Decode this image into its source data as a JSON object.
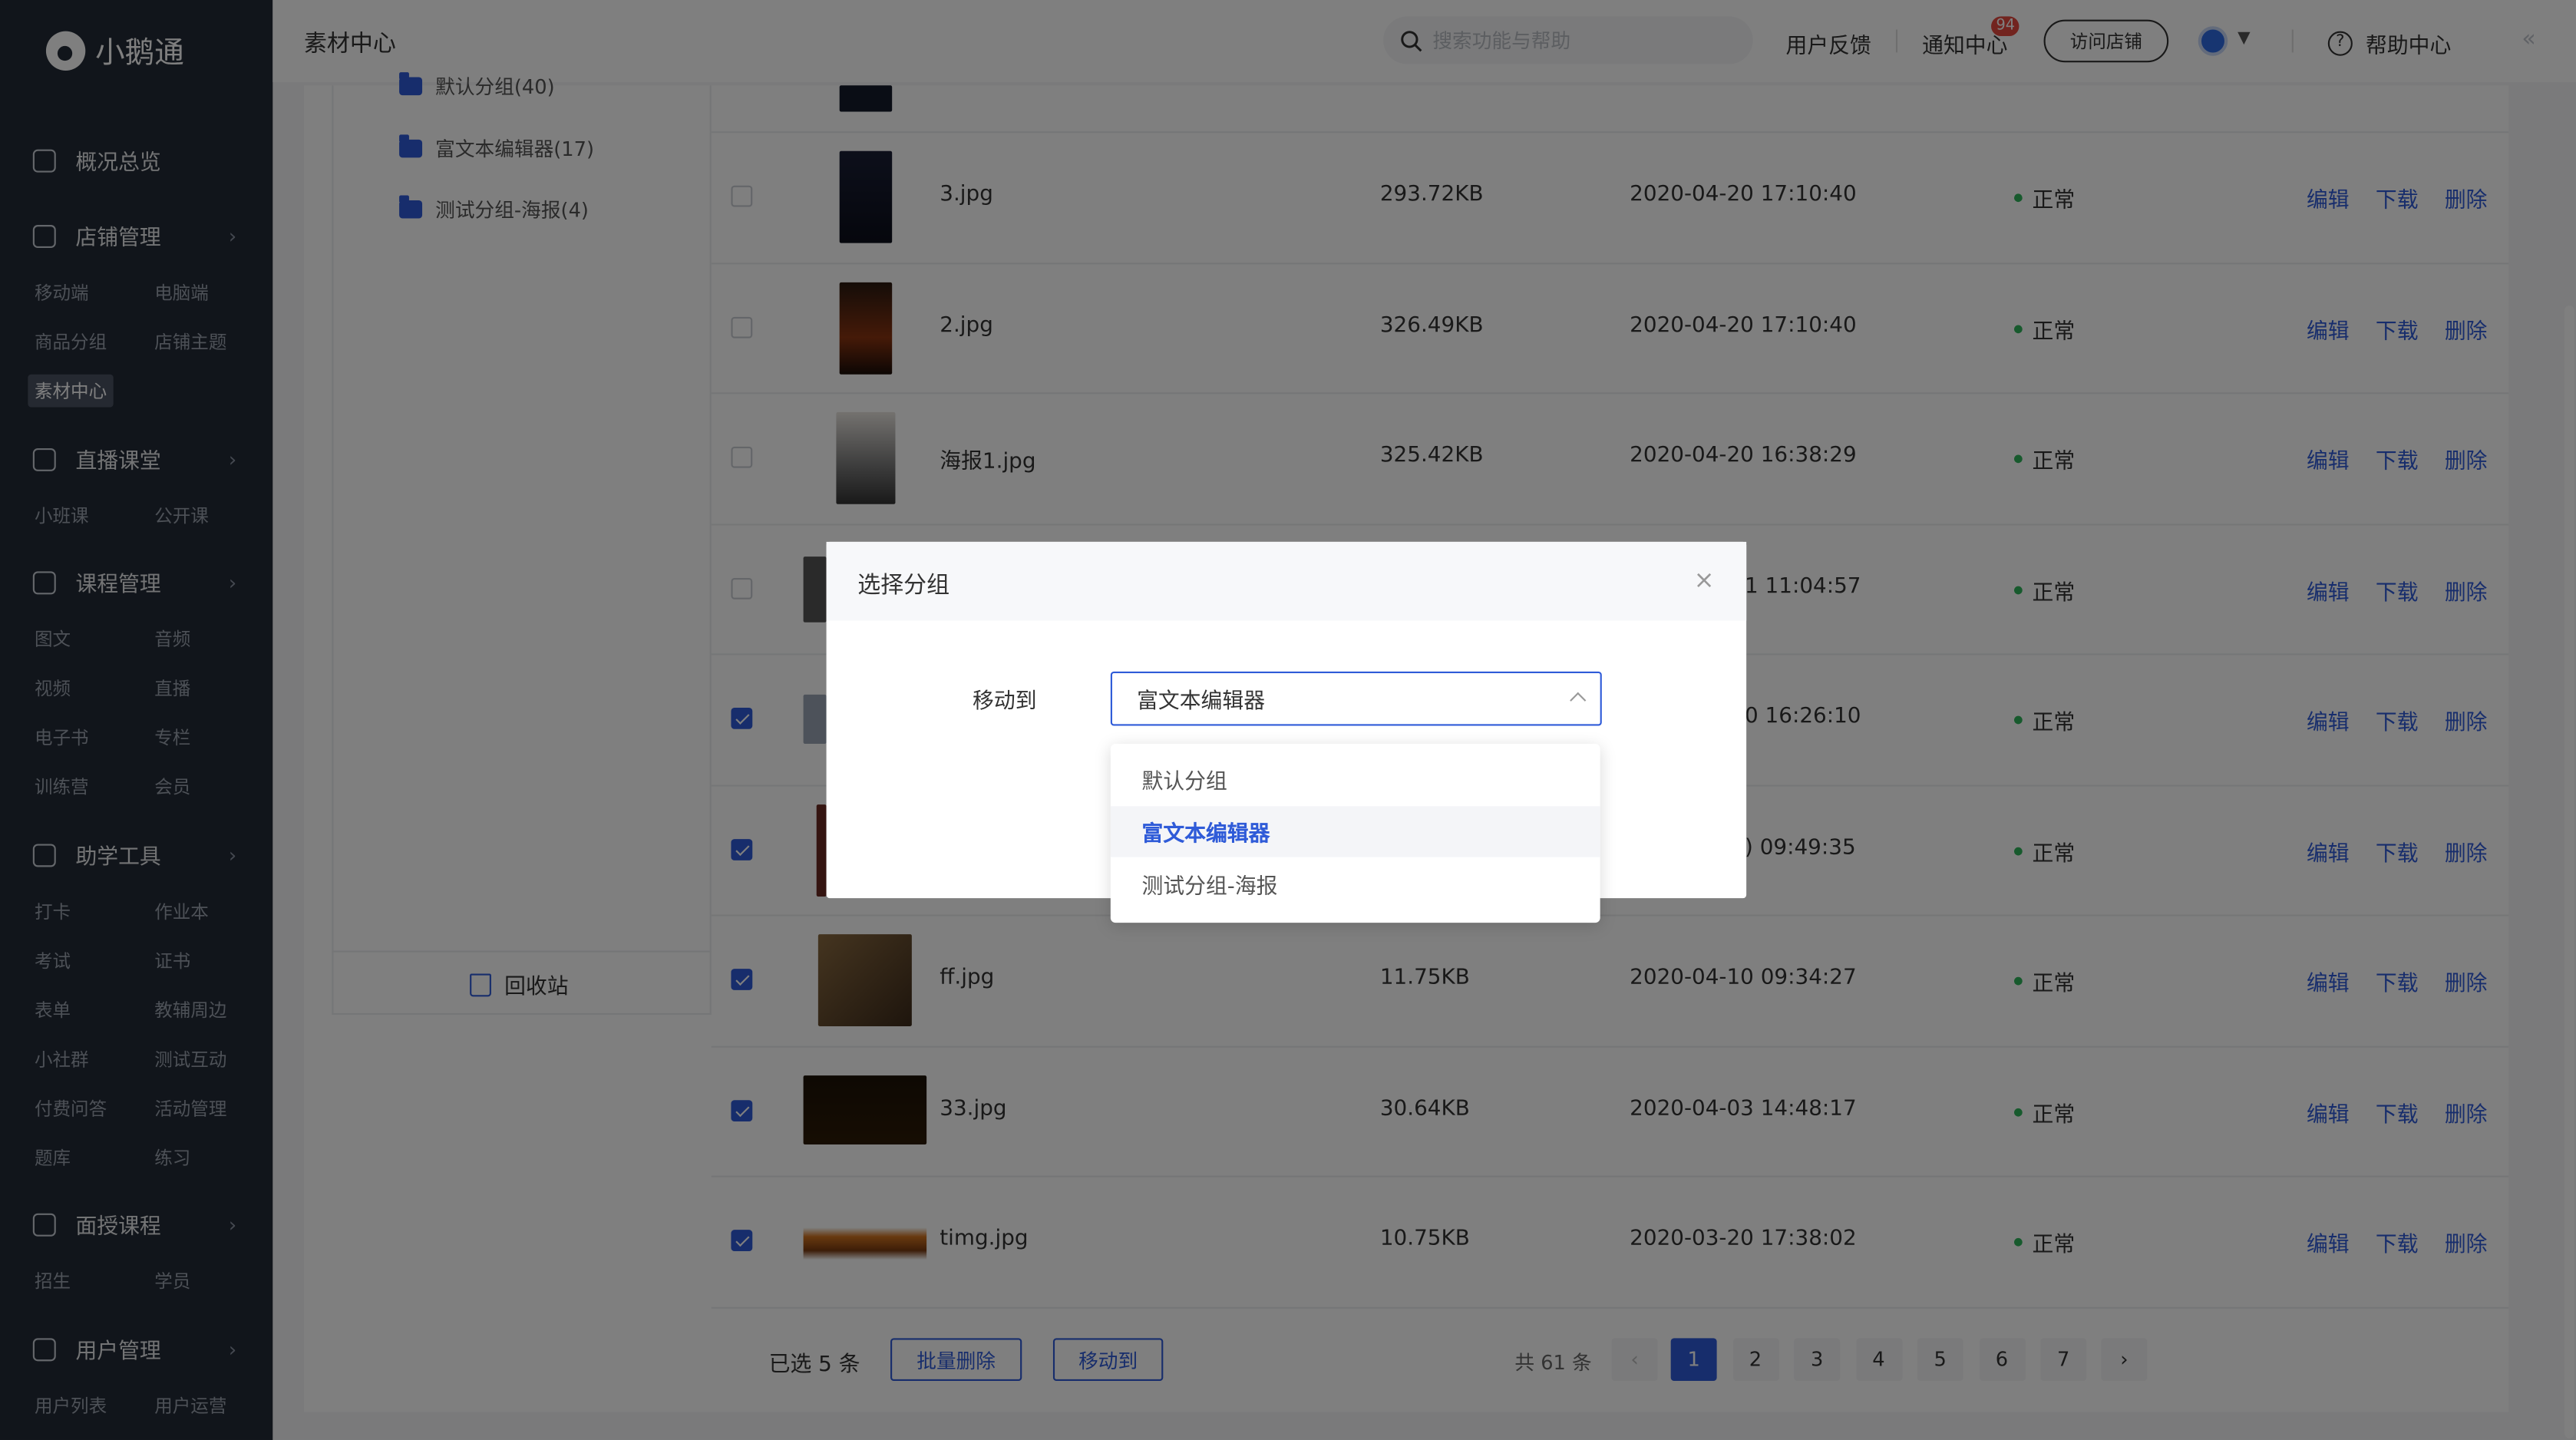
{
  "brand": {
    "name": "小鹅通"
  },
  "sidebar": {
    "groups": [
      {
        "label": "概况总览",
        "items": []
      },
      {
        "label": "店铺管理",
        "items": [
          "移动端",
          "电脑端",
          "商品分组",
          "店铺主题",
          "素材中心"
        ]
      },
      {
        "label": "直播课堂",
        "items": [
          "小班课",
          "公开课"
        ]
      },
      {
        "label": "课程管理",
        "items": [
          "图文",
          "音频",
          "视频",
          "直播",
          "电子书",
          "专栏",
          "训练营",
          "会员"
        ]
      },
      {
        "label": "助学工具",
        "items": [
          "打卡",
          "作业本",
          "考试",
          "证书",
          "表单",
          "教辅周边",
          "小社群",
          "测试互动",
          "付费问答",
          "活动管理",
          "题库",
          "练习"
        ]
      },
      {
        "label": "面授课程",
        "items": [
          "招生",
          "学员"
        ]
      },
      {
        "label": "用户管理",
        "items": [
          "用户列表",
          "用户运营"
        ]
      }
    ],
    "active_item": "素材中心"
  },
  "header": {
    "page_title": "素材中心",
    "search_placeholder": "搜索功能与帮助",
    "feedback": "用户反馈",
    "notice": "通知中心",
    "notice_badge": "94",
    "visit_store": "访问店铺",
    "help": "帮助中心"
  },
  "groups_panel": {
    "partial": "默认分组(40)",
    "items": [
      "富文本编辑器(17)",
      "测试分组-海报(4)"
    ],
    "recycle": "回收站"
  },
  "table": {
    "rows": [
      {
        "name": "3.jpg",
        "size": "293.72KB",
        "time": "2020-04-20 17:10:40",
        "status": "正常",
        "checked": false
      },
      {
        "name": "2.jpg",
        "size": "326.49KB",
        "time": "2020-04-20 17:10:40",
        "status": "正常",
        "checked": false
      },
      {
        "name": "海报1.jpg",
        "size": "325.42KB",
        "time": "2020-04-20 16:38:29",
        "status": "正常",
        "checked": false
      },
      {
        "name": "",
        "size": "",
        "time": "1 11:04:57",
        "status": "正常",
        "checked": false
      },
      {
        "name": "",
        "size": "",
        "time": "0 16:26:10",
        "status": "正常",
        "checked": true
      },
      {
        "name": "",
        "size": "",
        "time": ") 09:49:35",
        "status": "正常",
        "checked": true
      },
      {
        "name": "ff.jpg",
        "size": "11.75KB",
        "time": "2020-04-10 09:34:27",
        "status": "正常",
        "checked": true
      },
      {
        "name": "33.jpg",
        "size": "30.64KB",
        "time": "2020-04-03 14:48:17",
        "status": "正常",
        "checked": true
      },
      {
        "name": "timg.jpg",
        "size": "10.75KB",
        "time": "2020-03-20 17:38:02",
        "status": "正常",
        "checked": true
      }
    ],
    "ops": {
      "edit": "编辑",
      "download": "下载",
      "delete": "删除"
    }
  },
  "footer": {
    "selected": "已选 5 条",
    "batch_delete": "批量删除",
    "move_to": "移动到",
    "total": "共 61 条",
    "pages": [
      "1",
      "2",
      "3",
      "4",
      "5",
      "6",
      "7"
    ],
    "current_page": "1",
    "prev": "‹",
    "next": "›"
  },
  "modal": {
    "title": "选择分组",
    "close": "×",
    "label": "移动到",
    "selected": "富文本编辑器",
    "options": [
      "默认分组",
      "富文本编辑器",
      "测试分组-海报"
    ]
  },
  "colors": {
    "primary": "#2f5bd8",
    "sidebar_bg": "#232a36",
    "status_ok": "#2fb45a",
    "badge": "#e5483f"
  }
}
